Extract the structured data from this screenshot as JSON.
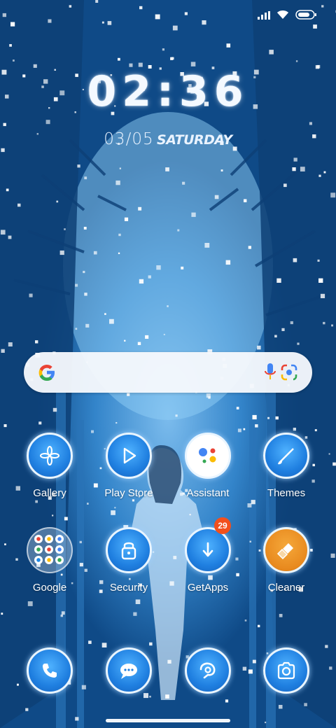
{
  "status_bar": {
    "icons": [
      "signal-icon",
      "wifi-icon",
      "battery-icon"
    ]
  },
  "clock": {
    "time": "02:36",
    "date": "03/05",
    "weekday": "SATURDAY"
  },
  "search_bar": {
    "icons": [
      "google-g-icon",
      "mic-icon",
      "lens-icon"
    ]
  },
  "apps": [
    {
      "label": "Gallery",
      "icon": "gallery-icon"
    },
    {
      "label": "Play Store",
      "icon": "play-store-icon"
    },
    {
      "label": "Assistant",
      "icon": "assistant-icon"
    },
    {
      "label": "Themes",
      "icon": "themes-icon"
    },
    {
      "label": "Google",
      "icon": "google-folder-icon"
    },
    {
      "label": "Security",
      "icon": "security-icon"
    },
    {
      "label": "GetApps",
      "icon": "getapps-icon",
      "badge": "29"
    },
    {
      "label": "Cleaner",
      "icon": "cleaner-icon"
    }
  ],
  "dock": [
    {
      "icon": "phone-icon"
    },
    {
      "icon": "messages-icon"
    },
    {
      "icon": "browser-icon"
    },
    {
      "icon": "camera-icon"
    }
  ],
  "colors": {
    "wallpaper_dark": "#0f4a87",
    "wallpaper_light": "#5fb0e8",
    "icon_blue": "#1f7fe0",
    "badge": "#f2501d",
    "cleaner_orange": "#e8891e"
  }
}
